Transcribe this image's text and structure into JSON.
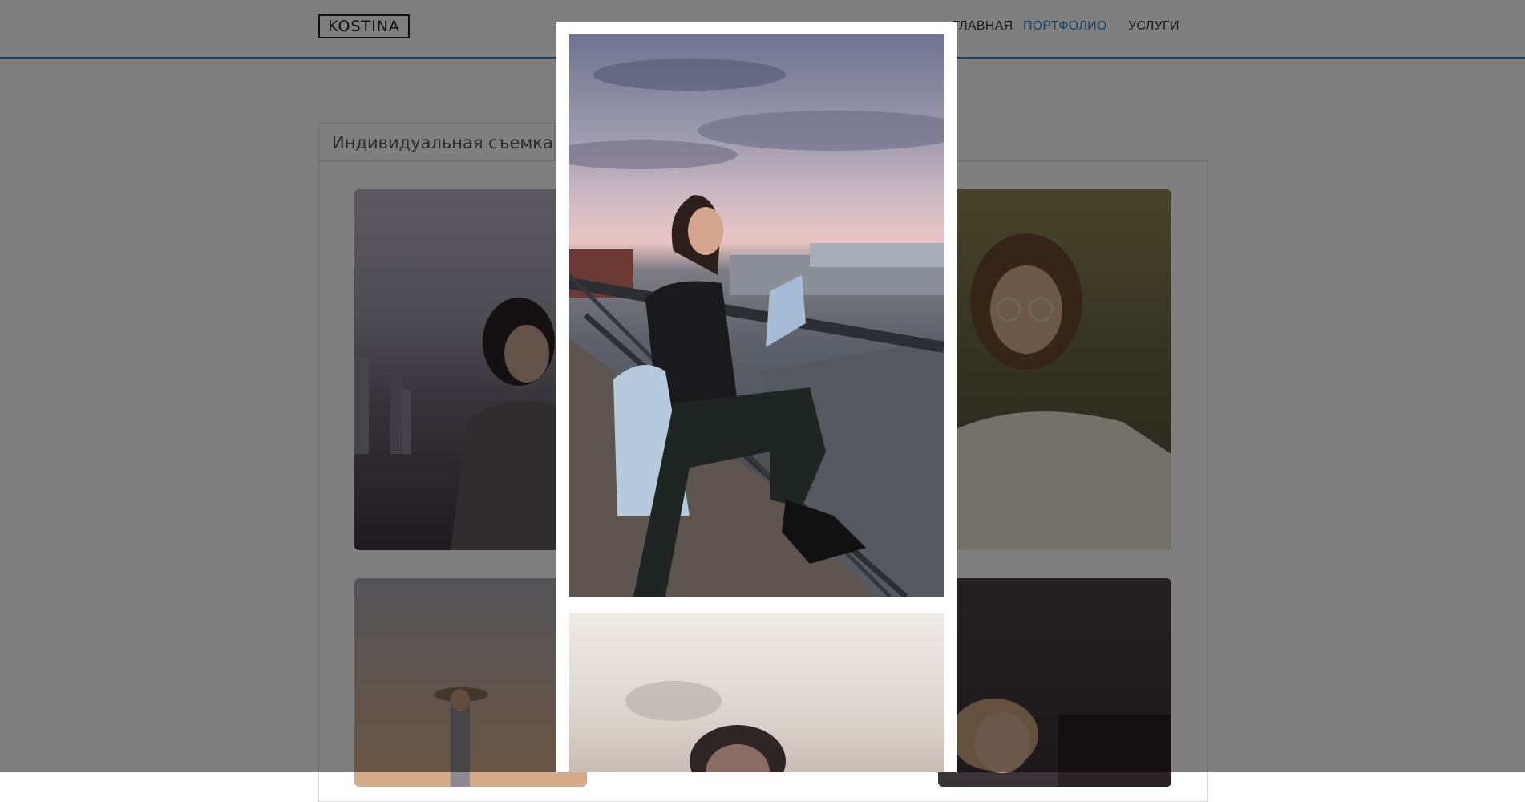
{
  "header": {
    "logo_text": "KOSTINA",
    "nav": [
      {
        "label": "ГЛАВНАЯ",
        "active": false
      },
      {
        "label": "ПОРТФОЛИО",
        "active": true
      },
      {
        "label": "УСЛУГИ",
        "active": false
      }
    ]
  },
  "tabs": [
    {
      "label": "Индивидуальная съемка",
      "active": true
    }
  ],
  "gallery": {
    "thumbnails": [
      {
        "subject": "woman in plaid coat, city background"
      },
      {
        "subject": "woman with glasses, neon sign"
      },
      {
        "subject": "woman in hat at sunset"
      },
      {
        "subject": "woman lying, smiling"
      }
    ]
  },
  "lightbox": {
    "images": [
      {
        "subject": "woman sitting on railing at dusk, denim jacket"
      },
      {
        "subject": "blurred portrait of woman against sky"
      }
    ]
  },
  "colors": {
    "accent": "#2b86d4",
    "overlay": "rgba(0,0,0,0.5)"
  }
}
